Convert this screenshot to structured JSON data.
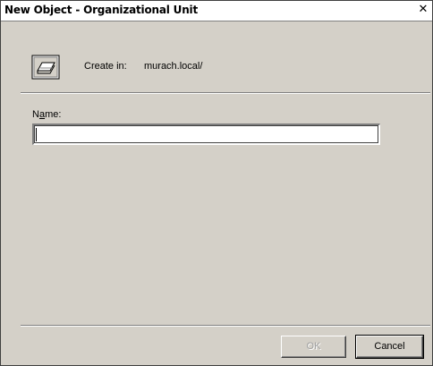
{
  "window": {
    "title": "New Object - Organizational Unit",
    "close_glyph": "✕"
  },
  "header": {
    "icon": "folder-icon",
    "create_in_label": "Create in:",
    "create_in_path": "murach.local/"
  },
  "form": {
    "name_label_prefix": "N",
    "name_label_accel": "a",
    "name_label_suffix": "me:",
    "name_value": ""
  },
  "buttons": {
    "ok_label": "OK",
    "ok_enabled": false,
    "cancel_label": "Cancel"
  },
  "colors": {
    "dialog_bg": "#d4d0c8",
    "title_bg": "#ffffff",
    "disabled_text": "#a0a0a0"
  }
}
